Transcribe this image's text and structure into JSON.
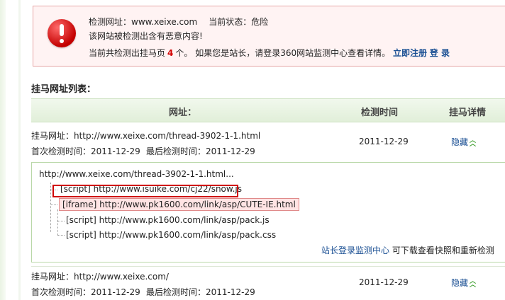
{
  "alert": {
    "url_label": "检测网址：",
    "url": "www.xeixe.com",
    "status_label": "当前状态：",
    "status": "危险",
    "message": "该网站被检测出含有恶意内容!",
    "count_prefix": "当前共检测出挂马页",
    "count": "4",
    "count_suffix": "个。 如果您是站长，请登录360网站监测中心查看详情。",
    "register_link": "立即注册",
    "login_link": "登 录"
  },
  "list_title": "挂马网址列表：",
  "table_header": {
    "url": "网址：",
    "time": "检测时间",
    "detail": "挂马详情"
  },
  "rows": [
    {
      "url_line": "挂马网址：http://www.xeixe.com/thread-3902-1-1.html",
      "first_check": "首次检测时间：2011-12-29",
      "last_check": "最后检测时间：2011-12-29",
      "date": "2011-12-29",
      "action": "隐藏"
    },
    {
      "url_line": "挂马网址：http://www.xeixe.com/",
      "first_check": "首次检测时间：2011-12-29",
      "last_check": "最后检测时间：2011-12-29",
      "date": "2011-12-29",
      "action": "隐藏"
    }
  ],
  "detail": {
    "root": "http://www.xeixe.com/thread-3902-1-1.html...",
    "nodes": [
      "[script] http://www.isuike.com/cj22/snow.js",
      "[iframe] http://www.pk1600.com/link/asp/CUTE-IE.html",
      "[script] http://www.pk1600.com/link/asp/pack.js",
      "[script] http://www.pk1600.com/link/asp/pack.css"
    ],
    "footer_link": "站长登录监测中心",
    "footer_text": " 可下载查看快照和重新检测"
  },
  "colors": {
    "accent_link": "#1a4f93",
    "danger": "#d30000",
    "header_green": "#e1efd9"
  }
}
